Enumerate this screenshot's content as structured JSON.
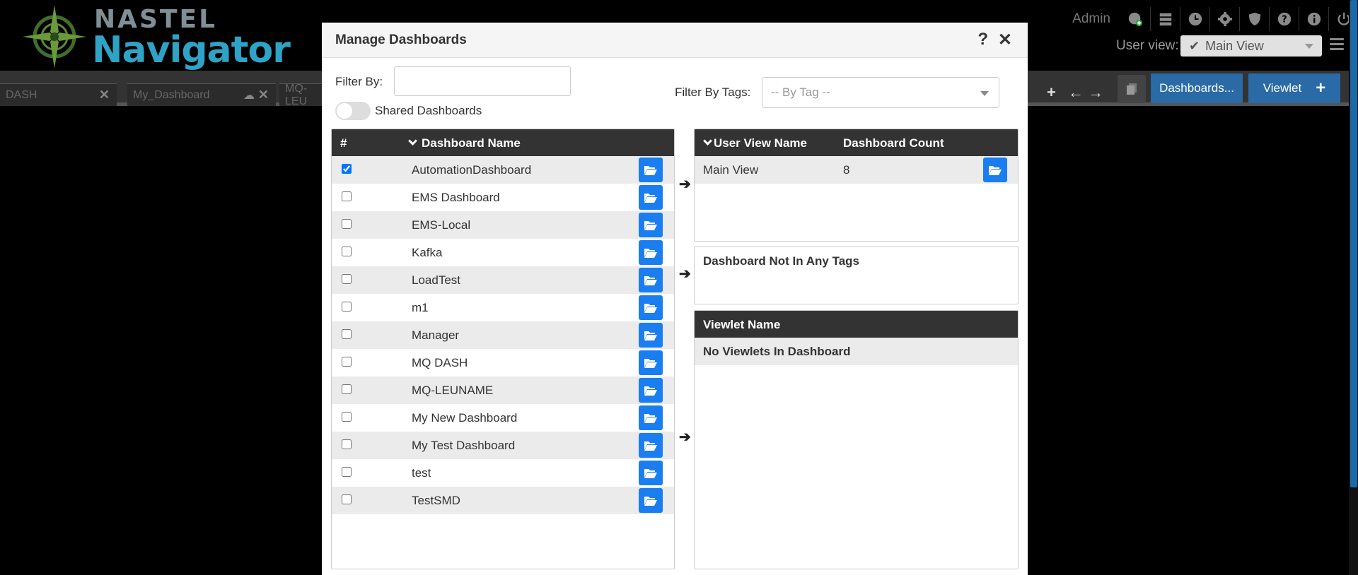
{
  "app": {
    "logo_top": "NASTEL",
    "logo_bottom": "Navigator",
    "user": "Admin",
    "user_view_label": "User view:",
    "user_view_value": "Main View"
  },
  "tabs": [
    {
      "label": "DASH"
    },
    {
      "label": "My_Dashboard"
    },
    {
      "label": "MQ-LEU"
    }
  ],
  "toolbar": {
    "dashboards_label": "Dashboards...",
    "viewlet_label": "Viewlet"
  },
  "modal": {
    "title": "Manage Dashboards",
    "filter_by_label": "Filter By:",
    "filter_by_value": "",
    "shared_label": "Shared Dashboards",
    "filter_tags_label": "Filter By Tags:",
    "filter_tags_placeholder": "-- By Tag --",
    "dash_table": {
      "col_num": "#",
      "col_name": "Dashboard Name",
      "rows": [
        {
          "name": "AutomationDashboard",
          "checked": true
        },
        {
          "name": "EMS Dashboard",
          "checked": false
        },
        {
          "name": "EMS-Local",
          "checked": false
        },
        {
          "name": "Kafka",
          "checked": false
        },
        {
          "name": "LoadTest",
          "checked": false
        },
        {
          "name": "m1",
          "checked": false
        },
        {
          "name": "Manager",
          "checked": false
        },
        {
          "name": "MQ DASH",
          "checked": false
        },
        {
          "name": "MQ-LEUNAME",
          "checked": false
        },
        {
          "name": "My New Dashboard",
          "checked": false
        },
        {
          "name": "My Test Dashboard",
          "checked": false
        },
        {
          "name": "test",
          "checked": false
        },
        {
          "name": "TestSMD",
          "checked": false
        }
      ]
    },
    "user_views": {
      "col_name": "User View Name",
      "col_count": "Dashboard Count",
      "rows": [
        {
          "name": "Main View",
          "count": "8"
        }
      ]
    },
    "tags_panel": {
      "title": "Dashboard Not In Any Tags"
    },
    "viewlets": {
      "col_name": "Viewlet Name",
      "empty": "No Viewlets In Dashboard"
    }
  },
  "colors": {
    "accent_blue": "#1a7ef0",
    "header_dark": "#333333",
    "row_alt": "#ebebeb",
    "logo_blue": "#2ea3c6"
  }
}
